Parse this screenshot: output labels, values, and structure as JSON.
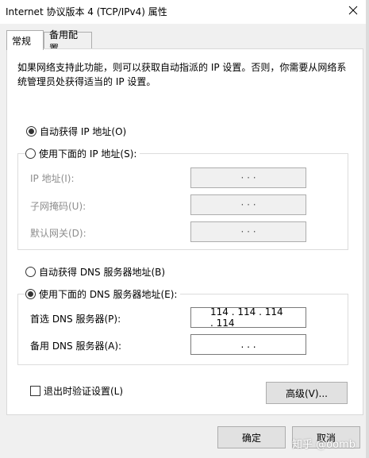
{
  "window": {
    "title": "Internet 协议版本 4 (TCP/IPv4) 属性",
    "close_glyph": "✕"
  },
  "tabs": [
    {
      "label": "常规",
      "active": true
    },
    {
      "label": "备用配置",
      "active": false
    }
  ],
  "intro_text": "如果网络支持此功能，则可以获取自动指派的 IP 设置。否则，你需要从网络系统管理员处获得适当的 IP 设置。",
  "ip": {
    "auto_label": "自动获得 IP 地址(O)",
    "manual_label": "使用下面的 IP 地址(S):",
    "auto_selected": true,
    "fields": [
      {
        "label": "IP 地址(I):",
        "dots": "·  ·  ·"
      },
      {
        "label": "子网掩码(U):",
        "dots": "·  ·  ·"
      },
      {
        "label": "默认网关(D):",
        "dots": "·  ·  ·"
      }
    ]
  },
  "dns": {
    "auto_label": "自动获得 DNS 服务器地址(B)",
    "manual_label": "使用下面的 DNS 服务器地址(E):",
    "manual_selected": true,
    "preferred_label": "首选 DNS 服务器(P):",
    "preferred_value": "114 . 114 . 114 . 114",
    "alternate_label": "备用 DNS 服务器(A):",
    "alternate_value": ".       .       ."
  },
  "validate_label": "退出时验证设置(L)",
  "advanced_label": "高级(V)...",
  "ok_label": "确定",
  "cancel_label": "取消",
  "watermark": "知乎 @oomb",
  "colors": {
    "dialog_bg": "#f0f0f0",
    "panel_bg": "#ffffff",
    "disabled_text": "#8d8d8d"
  }
}
